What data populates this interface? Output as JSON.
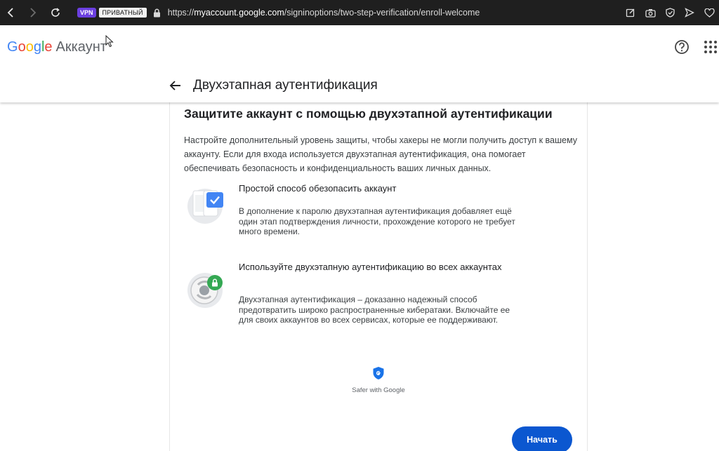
{
  "browser": {
    "vpn_label": "VPN",
    "private_label": "ПРИВАТНЫЙ",
    "url_prefix": "https://",
    "url_host": "myaccount.google.com",
    "url_path": "/signinoptions/two-step-verification/enroll-welcome"
  },
  "header": {
    "logo_g1": "G",
    "logo_o1": "o",
    "logo_o2": "o",
    "logo_g2": "g",
    "logo_l": "l",
    "logo_e": "e",
    "product": "Аккаунт",
    "page_title": "Двухэтапная аутентификация"
  },
  "main": {
    "heading": "Защитите аккаунт с помощью двухэтапной аутентификации",
    "intro": "Настройте дополнительный уровень защиты, чтобы хакеры не могли получить доступ к вашему аккаунту. Если для входа используется двухэтапная аутентификация, она помогает обеспечивать безопасность и конфиденциальность ваших личных данных.",
    "features": [
      {
        "title": "Простой способ обезопасить аккаунт",
        "desc": "В дополнение к паролю двухэтапная аутентификация добавляет ещё один этап подтверждения личности, прохождение которого не требует много времени."
      },
      {
        "title": "Используйте двухэтапную аутентификацию во всех аккаунтах",
        "desc": "Двухэтапная аутентификация – доказанно надежный способ предотвратить широко распространенные кибератаки. Включайте ее для своих аккаунтов во всех сервисах, которые ее поддерживают."
      }
    ],
    "safer_text": "Safer with Google",
    "start_button": "Начать"
  },
  "colors": {
    "accent": "#0b57d0",
    "vpn": "#6b3fe0",
    "check_blue": "#4285f4",
    "lock_green": "#34a853"
  }
}
